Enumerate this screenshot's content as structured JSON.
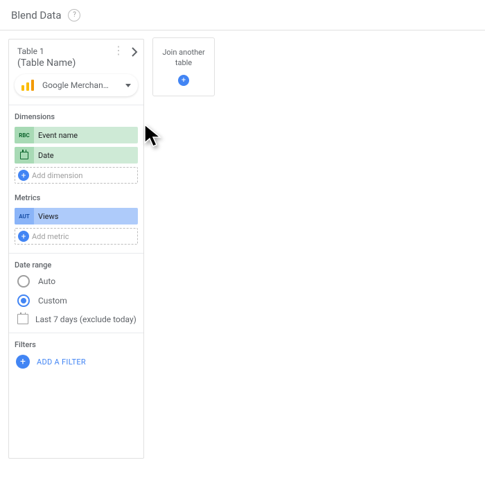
{
  "header": {
    "title": "Blend Data",
    "help": "?"
  },
  "table": {
    "title": "Table 1",
    "name": "(Table Name)",
    "dataSource": "Google Merchan…",
    "dimensions": {
      "title": "Dimensions",
      "items": [
        {
          "badge": "RBC",
          "label": "Event name",
          "icon": "text"
        },
        {
          "badge": "",
          "label": "Date",
          "icon": "calendar"
        }
      ],
      "add": "Add dimension"
    },
    "metrics": {
      "title": "Metrics",
      "items": [
        {
          "badge": "AUT",
          "label": "Views"
        }
      ],
      "add": "Add metric"
    },
    "dateRange": {
      "title": "Date range",
      "autoLabel": "Auto",
      "customLabel": "Custom",
      "selected": "custom",
      "value": "Last 7 days (exclude today)"
    },
    "filters": {
      "title": "Filters",
      "add": "ADD A FILTER"
    }
  },
  "join": {
    "label": "Join another table"
  }
}
